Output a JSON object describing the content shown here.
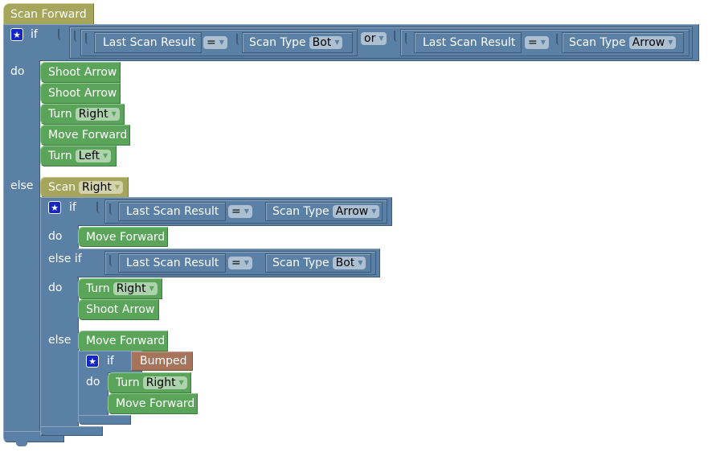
{
  "root": {
    "label": "Scan Forward"
  },
  "main_if": {
    "if_label": "if",
    "do_label": "do",
    "else_label": "else",
    "condition": {
      "left": {
        "field": "Last Scan Result",
        "op": "=",
        "type_label": "Scan Type",
        "type_value": "Bot"
      },
      "joiner": "or",
      "right": {
        "field": "Last Scan Result",
        "op": "=",
        "type_label": "Scan Type",
        "type_value": "Arrow"
      }
    },
    "do_blocks": [
      {
        "label": "Shoot Arrow"
      },
      {
        "label": "Shoot Arrow"
      },
      {
        "label": "Turn",
        "value": "Right"
      },
      {
        "label": "Move Forward"
      },
      {
        "label": "Turn",
        "value": "Left"
      }
    ]
  },
  "else_branch": {
    "scan": {
      "label": "Scan",
      "value": "Right"
    },
    "inner_if": {
      "if_label": "if",
      "do_label": "do",
      "else_if_label": "else if",
      "else_label": "else",
      "cond1": {
        "field": "Last Scan Result",
        "op": "=",
        "type_label": "Scan Type",
        "type_value": "Arrow"
      },
      "do1": [
        {
          "label": "Move Forward"
        }
      ],
      "cond2": {
        "field": "Last Scan Result",
        "op": "=",
        "type_label": "Scan Type",
        "type_value": "Bot"
      },
      "do2": [
        {
          "label": "Turn",
          "value": "Right"
        },
        {
          "label": "Shoot Arrow"
        }
      ],
      "else_blocks": [
        {
          "label": "Move Forward"
        }
      ],
      "nested_if": {
        "if_label": "if",
        "do_label": "do",
        "condition": "Bumped",
        "do_blocks": [
          {
            "label": "Turn",
            "value": "Right"
          },
          {
            "label": "Move Forward"
          }
        ]
      }
    }
  },
  "colors": {
    "logic": "#5b80a5",
    "action": "#5ba55b",
    "scan": "#a5a55b",
    "sensor": "#a5745b",
    "mutator": "#1427c4"
  },
  "icons": {
    "mutator": "★",
    "dropdown": "▼"
  }
}
